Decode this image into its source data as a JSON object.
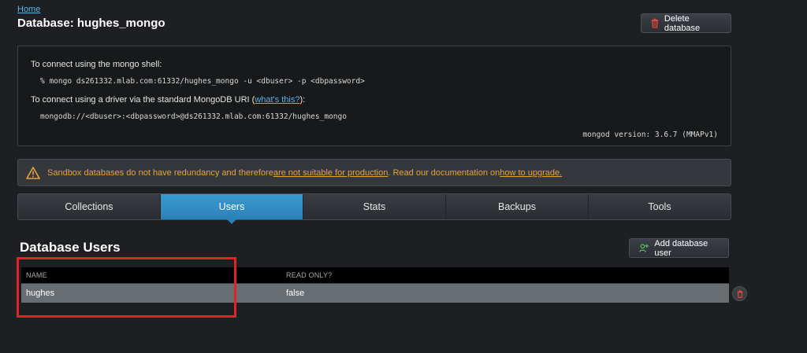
{
  "breadcrumb": {
    "home": "Home"
  },
  "header": {
    "title": "Database: hughes_mongo",
    "delete_button": "Delete database"
  },
  "connection": {
    "shell_label": "To connect using the mongo shell:",
    "shell_command": "% mongo ds261332.mlab.com:61332/hughes_mongo -u <dbuser> -p <dbpassword>",
    "driver_label_prefix": "To connect using a driver via the standard MongoDB URI (",
    "driver_link": "what's this?",
    "driver_label_suffix": "):",
    "uri": "mongodb://<dbuser>:<dbpassword>@ds261332.mlab.com:61332/hughes_mongo",
    "version": "mongod version: 3.6.7 (MMAPv1)"
  },
  "warning": {
    "text1": "Sandbox databases do not have redundancy and therefore ",
    "link1": "are not suitable for production",
    "text2": ". Read our documentation on ",
    "link2": "how to upgrade."
  },
  "tabs": [
    {
      "label": "Collections"
    },
    {
      "label": "Users"
    },
    {
      "label": "Stats"
    },
    {
      "label": "Backups"
    },
    {
      "label": "Tools"
    }
  ],
  "users": {
    "title": "Database Users",
    "add_button": "Add database user",
    "columns": {
      "name": "NAME",
      "read_only": "READ ONLY?"
    },
    "rows": [
      {
        "name": "hughes",
        "read_only": "false"
      }
    ]
  },
  "colors": {
    "active_tab": "#2a81b7",
    "warning_text": "#e9a23b",
    "highlight": "#e32227",
    "link": "#5ab4e8"
  }
}
